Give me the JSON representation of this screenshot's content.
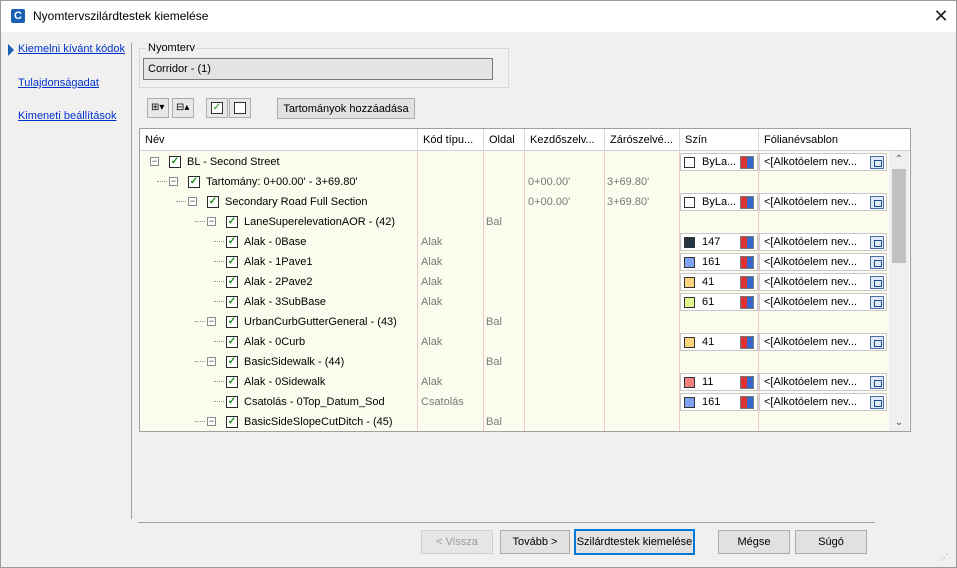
{
  "window": {
    "title": "Nyomtervszilárdtestek kiemelése",
    "app_icon": "civil3d-app-icon"
  },
  "nav": {
    "items": [
      {
        "label": "Kiemelni kívánt kódok",
        "active": true
      },
      {
        "label": "Tulajdonságadat",
        "active": false
      },
      {
        "label": "Kimeneti beállítások",
        "active": false
      }
    ]
  },
  "corridor_group": {
    "label": "Nyomterv",
    "value": "Corridor - (1)"
  },
  "toolbar": {
    "add_ranges_label": "Tartományok hozzáadása"
  },
  "grid": {
    "columns": [
      "Név",
      "Kód típu...",
      "Oldal",
      "Kezdőszelv...",
      "Zárószelvé...",
      "Szín",
      "Fólianévsablon"
    ],
    "rows": [
      {
        "level": 0,
        "name": "BL - Second Street",
        "code_type": "",
        "side": "",
        "start": "",
        "end": "",
        "color_hex": "#ffffff",
        "color_name": "ByLa...",
        "layer": "<[Alkotóelem nev...",
        "expander": true,
        "last": false
      },
      {
        "level": 1,
        "name": "Tartomány:  0+00.00' - 3+69.80'",
        "code_type": "",
        "side": "",
        "start": "0+00.00'",
        "end": "3+69.80'",
        "color_hex": "",
        "color_name": "",
        "layer": "",
        "expander": true,
        "last": false
      },
      {
        "level": 2,
        "name": "Secondary Road Full Section",
        "code_type": "",
        "side": "",
        "start": "0+00.00'",
        "end": "3+69.80'",
        "color_hex": "#ffffff",
        "color_name": "ByLa...",
        "layer": "<[Alkotóelem nev...",
        "expander": true,
        "last": false
      },
      {
        "level": 3,
        "name": "LaneSuperelevationAOR - (42)",
        "code_type": "",
        "side": "Bal",
        "start": "",
        "end": "",
        "color_hex": "",
        "color_name": "",
        "layer": "",
        "expander": true,
        "last": false
      },
      {
        "level": 4,
        "name": "Alak - 0Base",
        "code_type": "Alak",
        "side": "",
        "start": "",
        "end": "",
        "color_hex": "#253745",
        "color_name": "147",
        "layer": "<[Alkotóelem nev...",
        "expander": false,
        "last": false
      },
      {
        "level": 4,
        "name": "Alak - 1Pave1",
        "code_type": "Alak",
        "side": "",
        "start": "",
        "end": "",
        "color_hex": "#7fa3f2",
        "color_name": "161",
        "layer": "<[Alkotóelem nev...",
        "expander": false,
        "last": false
      },
      {
        "level": 4,
        "name": "Alak - 2Pave2",
        "code_type": "Alak",
        "side": "",
        "start": "",
        "end": "",
        "color_hex": "#f9d37e",
        "color_name": "41",
        "layer": "<[Alkotóelem nev...",
        "expander": false,
        "last": false
      },
      {
        "level": 4,
        "name": "Alak - 3SubBase",
        "code_type": "Alak",
        "side": "",
        "start": "",
        "end": "",
        "color_hex": "#dff58f",
        "color_name": "61",
        "layer": "<[Alkotóelem nev...",
        "expander": false,
        "last": true
      },
      {
        "level": 3,
        "name": "UrbanCurbGutterGeneral - (43)",
        "code_type": "",
        "side": "Bal",
        "start": "",
        "end": "",
        "color_hex": "",
        "color_name": "",
        "layer": "",
        "expander": true,
        "last": false
      },
      {
        "level": 4,
        "name": "Alak - 0Curb",
        "code_type": "Alak",
        "side": "",
        "start": "",
        "end": "",
        "color_hex": "#f9d37e",
        "color_name": "41",
        "layer": "<[Alkotóelem nev...",
        "expander": false,
        "last": true
      },
      {
        "level": 3,
        "name": "BasicSidewalk - (44)",
        "code_type": "",
        "side": "Bal",
        "start": "",
        "end": "",
        "color_hex": "",
        "color_name": "",
        "layer": "",
        "expander": true,
        "last": false
      },
      {
        "level": 4,
        "name": "Alak - 0Sidewalk",
        "code_type": "Alak",
        "side": "",
        "start": "",
        "end": "",
        "color_hex": "#f07f7f",
        "color_name": "11",
        "layer": "<[Alkotóelem nev...",
        "expander": false,
        "last": false
      },
      {
        "level": 4,
        "name": "Csatolás - 0Top_Datum_Sod",
        "code_type": "Csatolás",
        "side": "",
        "start": "",
        "end": "",
        "color_hex": "#7fa3f2",
        "color_name": "161",
        "layer": "<[Alkotóelem nev...",
        "expander": false,
        "last": true
      },
      {
        "level": 3,
        "name": "BasicSideSlopeCutDitch - (45)",
        "code_type": "",
        "side": "Bal",
        "start": "",
        "end": "",
        "color_hex": "",
        "color_name": "",
        "layer": "",
        "expander": true,
        "last": false
      }
    ],
    "scroll_position_fraction": 0.0
  },
  "buttons": {
    "back": "< Vissza",
    "next": "Tovább >",
    "extract": "Szilárdtestek kiemelése",
    "cancel": "Mégse",
    "help": "Súgó"
  }
}
